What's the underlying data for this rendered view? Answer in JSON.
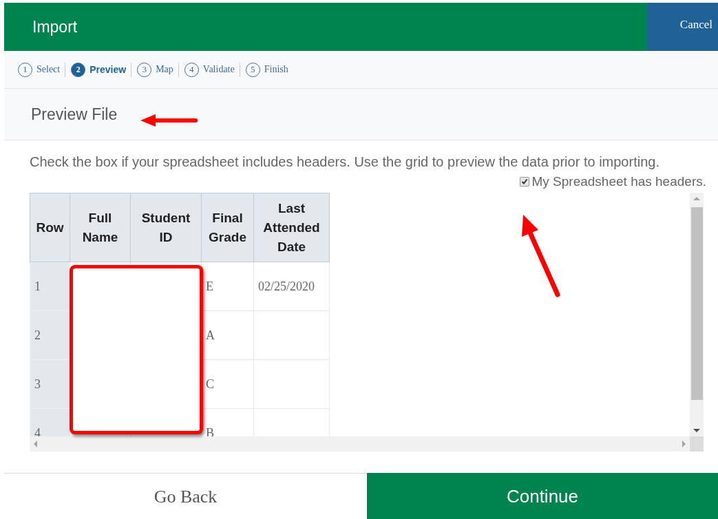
{
  "header": {
    "title": "Import",
    "cancel": "Cancel"
  },
  "steps": [
    {
      "number": "1",
      "label": "Select",
      "selected": false
    },
    {
      "number": "2",
      "label": "Preview",
      "selected": true
    },
    {
      "number": "3",
      "label": "Map",
      "selected": false
    },
    {
      "number": "4",
      "label": "Validate",
      "selected": false
    },
    {
      "number": "5",
      "label": "Finish",
      "selected": false
    }
  ],
  "section_title": "Preview File",
  "instructions": "Check the box if your spreadsheet includes headers. Use the grid to preview the data prior to importing.",
  "headers_checkbox": {
    "label": "My Spreadsheet has headers.",
    "checked": true
  },
  "table": {
    "columns": [
      "Row",
      "Full Name",
      "Student ID",
      "Final Grade",
      "Last Attended Date"
    ],
    "rows": [
      {
        "row": "1",
        "final_grade": "E",
        "last_attended_date": "02/25/2020"
      },
      {
        "row": "2",
        "final_grade": "A"
      },
      {
        "row": "3",
        "final_grade": "C"
      },
      {
        "row": "4",
        "final_grade": "B"
      }
    ]
  },
  "footer": {
    "back": "Go Back",
    "continue": "Continue"
  }
}
